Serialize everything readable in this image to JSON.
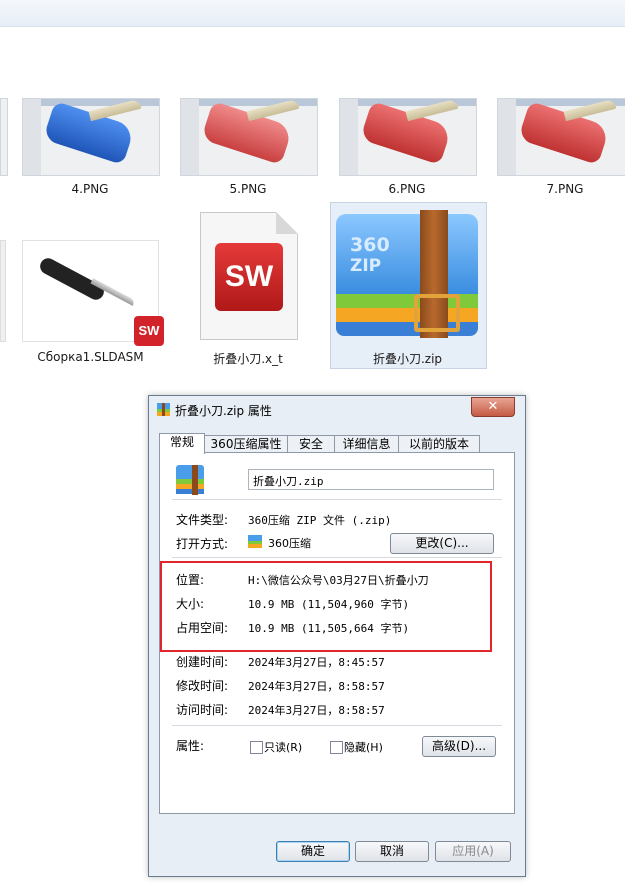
{
  "files": [
    {
      "name": "4.PNG"
    },
    {
      "name": "5.PNG"
    },
    {
      "name": "6.PNG"
    },
    {
      "name": "7.PNG"
    },
    {
      "name": "Сборка1.SLDASM"
    },
    {
      "name": "折叠小刀.x_t"
    },
    {
      "name": "折叠小刀.zip"
    }
  ],
  "thumb_colors": [
    "#3b78d8",
    "#e06060",
    "#d84848",
    "#d84848"
  ],
  "dialog": {
    "title": "折叠小刀.zip 属性",
    "close_symbol": "✕",
    "tabs": [
      "常规",
      "360压缩属性",
      "安全",
      "详细信息",
      "以前的版本"
    ],
    "filename_value": "折叠小刀.zip",
    "file_type_label": "文件类型:",
    "file_type_value": "360压缩 ZIP 文件 (.zip)",
    "open_with_label": "打开方式:",
    "open_with_value": "360压缩",
    "change_button": "更改(C)...",
    "location_label": "位置:",
    "location_value": "H:\\微信公众号\\03月27日\\折叠小刀",
    "size_label": "大小:",
    "size_value": "10.9 MB (11,504,960 字节)",
    "disk_size_label": "占用空间:",
    "disk_size_value": "10.9 MB (11,505,664 字节)",
    "created_label": "创建时间:",
    "created_value": "2024年3月27日，8:45:57",
    "modified_label": "修改时间:",
    "modified_value": "2024年3月27日，8:58:57",
    "accessed_label": "访问时间:",
    "accessed_value": "2024年3月27日，8:58:57",
    "attributes_label": "属性:",
    "readonly_label": "只读(R)",
    "hidden_label": "隐藏(H)",
    "advanced_button": "高级(D)...",
    "ok_button": "确定",
    "cancel_button": "取消",
    "apply_button": "应用(A)"
  },
  "icons": {
    "sw_text": "SW",
    "zip_text_1": "360",
    "zip_text_2": "ZIP"
  }
}
